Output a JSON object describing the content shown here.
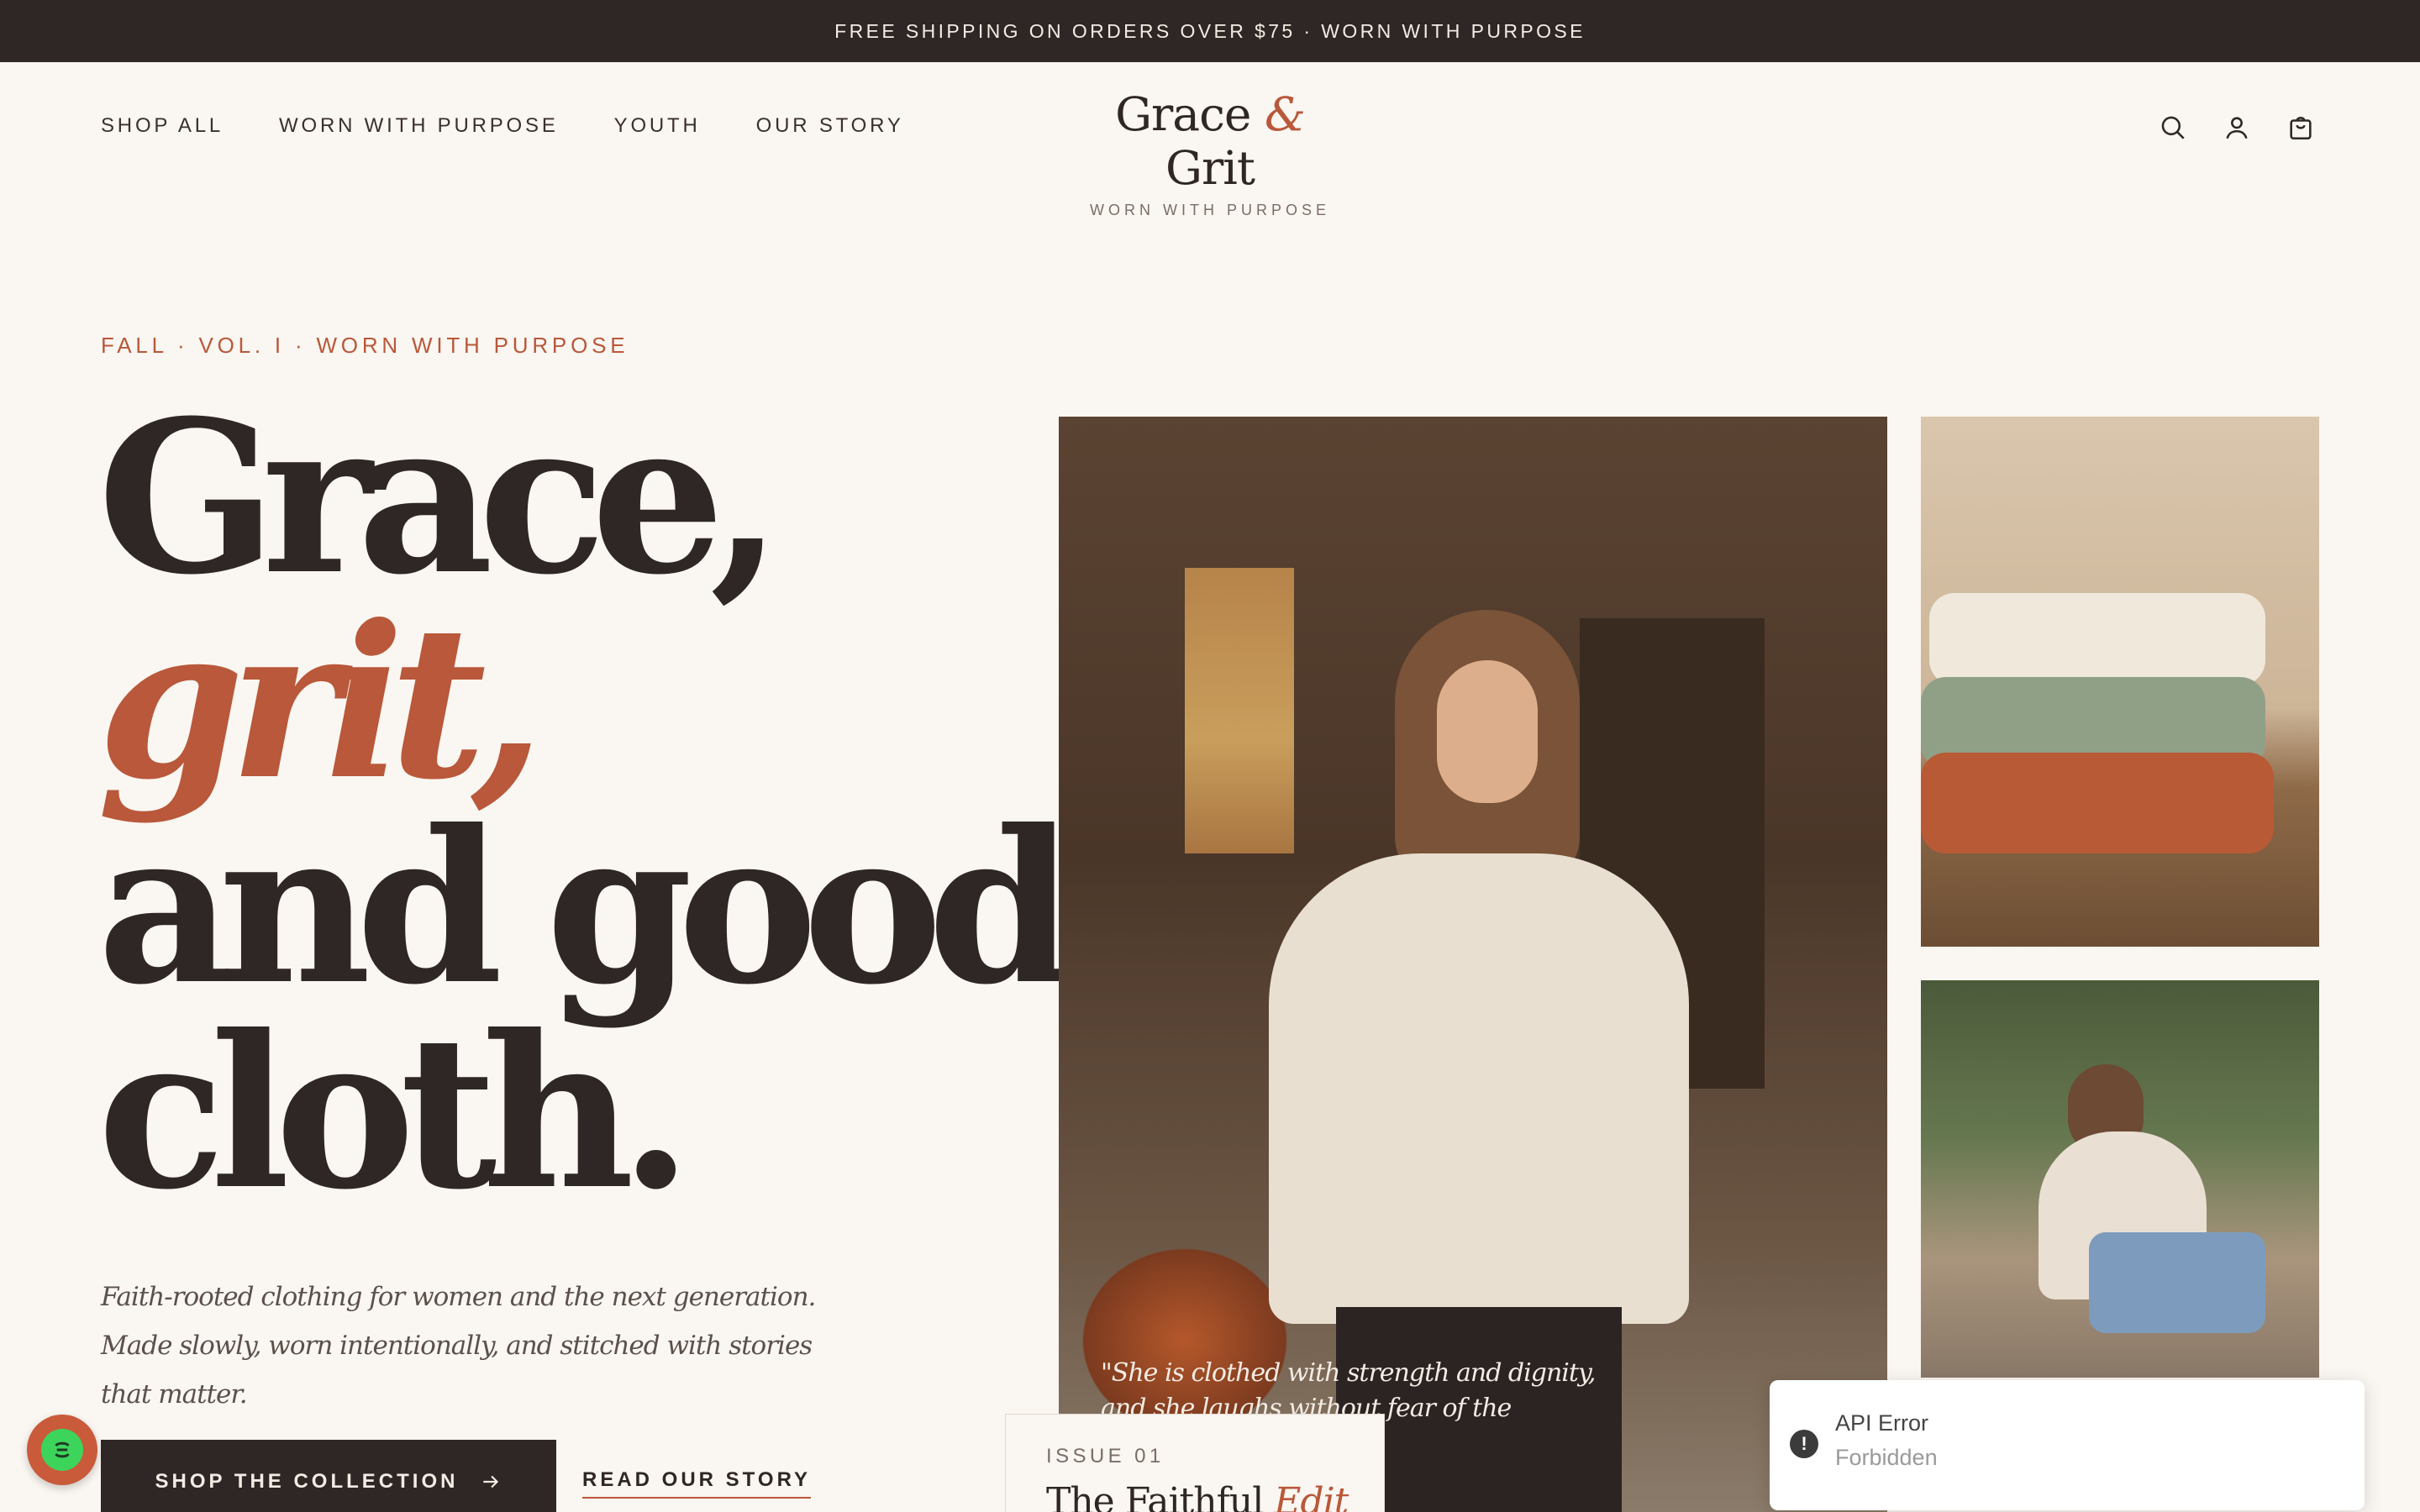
{
  "announcement": "FREE SHIPPING ON ORDERS OVER $75 · WORN WITH PURPOSE",
  "nav": {
    "items": [
      {
        "label": "SHOP ALL"
      },
      {
        "label": "WORN WITH PURPOSE"
      },
      {
        "label": "YOUTH"
      },
      {
        "label": "OUR STORY"
      }
    ]
  },
  "logo": {
    "word1": "Grace",
    "amp": "&",
    "word2": "Grit",
    "tagline": "WORN WITH PURPOSE"
  },
  "header_icons": [
    "search-icon",
    "account-icon",
    "cart-icon"
  ],
  "hero": {
    "eyebrow": "FALL · VOL. I · WORN WITH PURPOSE",
    "headline": {
      "line1": "Grace,",
      "line2": "grit,",
      "line3": "and good",
      "line4": "cloth."
    },
    "subtitle": "Faith-rooted clothing for women and the next generation. Made slowly, worn intentionally, and stitched with stories that matter.",
    "primary_cta": "SHOP THE COLLECTION",
    "secondary_cta": "READ OUR STORY"
  },
  "quote": "\"She is clothed with strength and dignity, and she laughs without fear of the future.\"",
  "issue_card": {
    "label": "ISSUE 01",
    "title_main": "The Faithful",
    "title_accent": "Edit"
  },
  "toast": {
    "title": "API Error",
    "message": "Forbidden"
  },
  "colors": {
    "accent": "#b9583a",
    "dark": "#2f2725",
    "background": "#faf6f1",
    "chat_bubble": "#c95a3a"
  }
}
